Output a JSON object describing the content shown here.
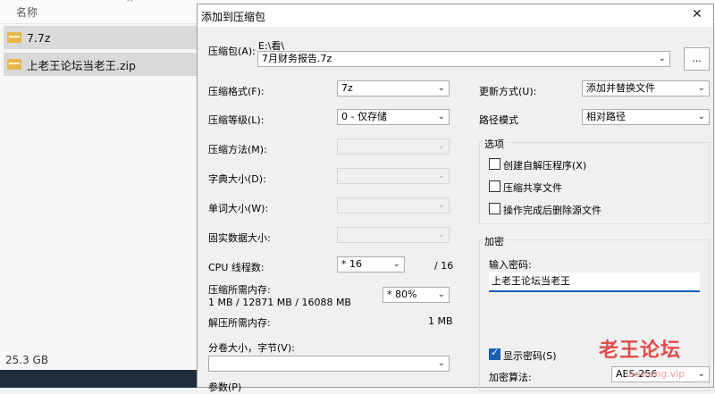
{
  "explorer": {
    "column_name": "名称",
    "files": [
      "7.7z",
      "上老王论坛当老王.zip"
    ],
    "status": "25.3 GB"
  },
  "dialog": {
    "title": "添加到压缩包",
    "close": "✕",
    "archive_label": "压缩包(A):",
    "archive_path": "E:\\看\\",
    "archive_name": "7月财务报告.7z",
    "browse": "...",
    "format_label": "压缩格式(F):",
    "format_value": "7z",
    "level_label": "压缩等级(L):",
    "level_value": "0 - 仅存储",
    "method_label": "压缩方法(M):",
    "dict_label": "字典大小(D):",
    "word_label": "单词大小(W):",
    "solid_label": "固实数据大小:",
    "cpu_label": "CPU 线程数:",
    "cpu_value": "* 16",
    "cpu_total": "/ 16",
    "mem_label": "压缩所需内存:",
    "mem_detail": "1 MB / 12871 MB / 16088 MB",
    "mem_value": "* 80%",
    "decomp_label": "解压所需内存:",
    "decomp_value": "1 MB",
    "split_label": "分卷大小，字节(V):",
    "params_label": "参数(P)",
    "update_label": "更新方式(U):",
    "update_value": "添加并替换文件",
    "pathmode_label": "路径模式",
    "pathmode_value": "相对路径",
    "options_title": "选项",
    "opt_sfx": "创建自解压程序(X)",
    "opt_shared": "压缩共享文件",
    "opt_delete": "操作完成后删除源文件",
    "encrypt_title": "加密",
    "password_label": "输入密码:",
    "password_value": "上老王论坛当老王",
    "show_password": "显示密码(S)",
    "enc_method_label": "加密算法:",
    "enc_method_value": "AES-256"
  },
  "watermark": {
    "text": "老王论坛",
    "url": "laowang.vip"
  }
}
